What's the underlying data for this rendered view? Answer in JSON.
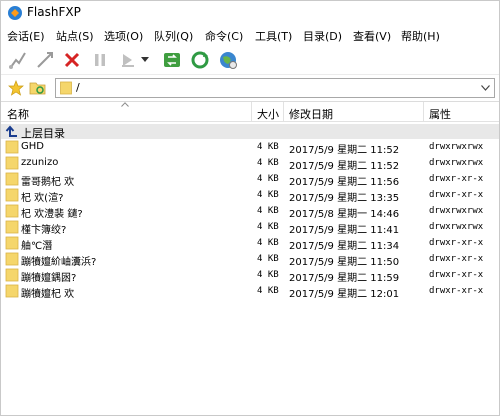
{
  "window": {
    "title": "FlashFXP"
  },
  "menu": [
    {
      "label": "会话(E)"
    },
    {
      "label": "站点(S)"
    },
    {
      "label": "选项(O)"
    },
    {
      "label": "队列(Q)"
    },
    {
      "label": "命令(C)"
    },
    {
      "label": "工具(T)"
    },
    {
      "label": "目录(D)"
    },
    {
      "label": "查看(V)"
    },
    {
      "label": "帮助(H)"
    }
  ],
  "toolbar": {
    "icons": [
      "connect-icon",
      "quick-connect-icon",
      "disconnect-icon",
      "pause-icon",
      "transfer-icon",
      "dropdown-arrow-icon",
      "sync-icon",
      "refresh-icon",
      "globe-icon"
    ]
  },
  "pathbar": {
    "path": "/"
  },
  "columns": {
    "name": "名称",
    "size": "大小",
    "date": "修改日期",
    "attr": "属性"
  },
  "parent": {
    "label": "上层目录"
  },
  "files": [
    {
      "name": "GHD",
      "size": "4 KB",
      "date": "2017/5/9 星期二 11:52",
      "attr": "drwxrwxrwx"
    },
    {
      "name": "zzunizo",
      "size": "4 KB",
      "date": "2017/5/9 星期二 11:52",
      "attr": "drwxrwxrwx"
    },
    {
      "name": "雷哥鹅杞  欢",
      "size": "4 KB",
      "date": "2017/5/9 星期二 11:56",
      "attr": "drwxr-xr-x"
    },
    {
      "name": "杞  欢(渲?",
      "size": "4 KB",
      "date": "2017/5/9 星期二 13:35",
      "attr": "drwxr-xr-x"
    },
    {
      "name": "杞  欢澧裴   鑓?",
      "size": "4 KB",
      "date": "2017/5/8 星期一 14:46",
      "attr": "drwxrwxrwx"
    },
    {
      "name": "槿卞簿绞?",
      "size": "4 KB",
      "date": "2017/5/9 星期二 11:41",
      "attr": "drwxrwxrwx"
    },
    {
      "name": "舳℃潛",
      "size": "4 KB",
      "date": "2017/5/9 星期二 11:34",
      "attr": "drwxr-xr-x"
    },
    {
      "name": "蹦犢嬗紒岫瀵浜?",
      "size": "4 KB",
      "date": "2017/5/9 星期二 11:50",
      "attr": "drwxr-xr-x"
    },
    {
      "name": "蹦犢嬗鍝囦?",
      "size": "4 KB",
      "date": "2017/5/9 星期二 11:59",
      "attr": "drwxr-xr-x"
    },
    {
      "name": "蹦犢嬗杞  欢",
      "size": "4 KB",
      "date": "2017/5/9 星期二 12:01",
      "attr": "drwxr-xr-x"
    }
  ],
  "colors": {
    "folder": "#f5d66b",
    "folder_edge": "#d9b446",
    "up_row": "#e8e8e8"
  }
}
